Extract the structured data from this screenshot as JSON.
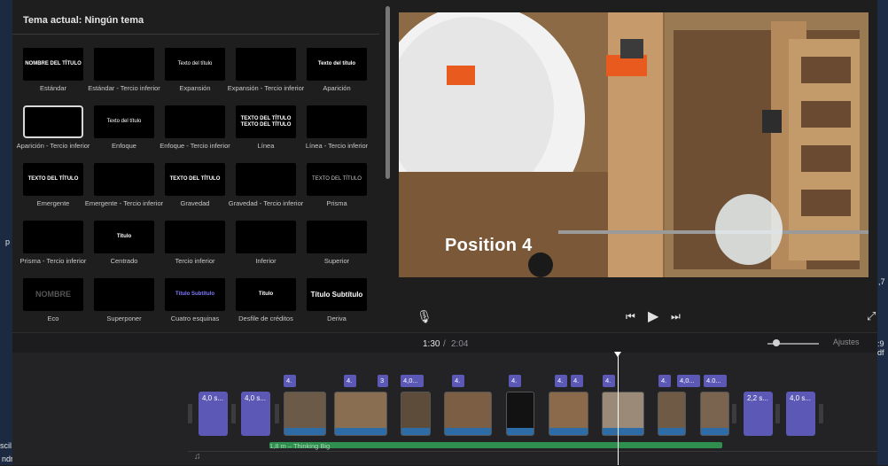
{
  "browser": {
    "title": "Tema actual: Ningún tema",
    "tiles": [
      {
        "label": "Estándar",
        "preview": "NOMBRE DEL TÍTULO",
        "selected": false
      },
      {
        "label": "Estándar - Tercio inferior",
        "preview": "",
        "selected": false
      },
      {
        "label": "Expansión",
        "preview": "Texto del título",
        "selected": false
      },
      {
        "label": "Expansión - Tercio inferior",
        "preview": "",
        "selected": false
      },
      {
        "label": "Aparición",
        "preview": "Texto del título",
        "selected": false
      },
      {
        "label": "Aparición - Tercio inferior",
        "preview": "",
        "selected": true
      },
      {
        "label": "Enfoque",
        "preview": "Texto del título",
        "selected": false
      },
      {
        "label": "Enfoque - Tercio inferior",
        "preview": "",
        "selected": false
      },
      {
        "label": "Línea",
        "preview": "TEXTO DEL TÍTULO TEXTO DEL TÍTULO",
        "selected": false
      },
      {
        "label": "Línea - Tercio inferior",
        "preview": "",
        "selected": false
      },
      {
        "label": "Emergente",
        "preview": "TEXTO DEL TÍTULO",
        "selected": false
      },
      {
        "label": "Emergente - Tercio inferior",
        "preview": "",
        "selected": false
      },
      {
        "label": "Gravedad",
        "preview": "TEXTO DEL TÍTULO",
        "selected": false
      },
      {
        "label": "Gravedad - Tercio inferior",
        "preview": "",
        "selected": false
      },
      {
        "label": "Prisma",
        "preview": "TEXTO DEL TÍTULO",
        "selected": false
      },
      {
        "label": "Prisma - Tercio inferior",
        "preview": "",
        "selected": false
      },
      {
        "label": "Centrado",
        "preview": "Título",
        "selected": false
      },
      {
        "label": "Tercio inferior",
        "preview": "",
        "selected": false
      },
      {
        "label": "Inferior",
        "preview": "",
        "selected": false
      },
      {
        "label": "Superior",
        "preview": "",
        "selected": false
      },
      {
        "label": "Eco",
        "preview": "NOMBRE",
        "selected": false
      },
      {
        "label": "Superponer",
        "preview": "",
        "selected": false
      },
      {
        "label": "Cuatro esquinas",
        "preview": "Título Subtítulo",
        "selected": false
      },
      {
        "label": "Desfile de créditos",
        "preview": "Título",
        "selected": false
      },
      {
        "label": "Deriva",
        "preview": "Título Subtítulo",
        "selected": false
      }
    ]
  },
  "viewer": {
    "overlay_text": "Position 4"
  },
  "transport": {
    "current_time": "1:30",
    "separator": "/",
    "total_time": "2:04",
    "settings_label": "Ajustes",
    "zoom_level": 0.2
  },
  "timeline": {
    "clips": [
      {
        "kind": "title",
        "label": "4,0 s..."
      },
      {
        "kind": "title",
        "label": "4,0 s..."
      },
      {
        "kind": "video",
        "label": ""
      },
      {
        "kind": "video",
        "label": ""
      },
      {
        "kind": "video",
        "label": ""
      },
      {
        "kind": "video",
        "label": ""
      },
      {
        "kind": "video",
        "label": ""
      },
      {
        "kind": "video",
        "label": ""
      },
      {
        "kind": "video",
        "label": ""
      },
      {
        "kind": "video",
        "label": ""
      },
      {
        "kind": "video",
        "label": ""
      },
      {
        "kind": "title",
        "label": "2,2 s..."
      },
      {
        "kind": "title",
        "label": "4,0 s..."
      }
    ],
    "overlays": [
      "4.",
      "4.",
      "3",
      "4,0...",
      "4.",
      "4.",
      "4.",
      "4.",
      "4.",
      "4.",
      "4,0...",
      "4.0..."
    ],
    "audio_label": "1,8 m – Thinking Big"
  },
  "colors": {
    "title_clip": "#5b58b6",
    "audio_clip": "#2f8f4f",
    "accent": "#ffffff"
  }
}
